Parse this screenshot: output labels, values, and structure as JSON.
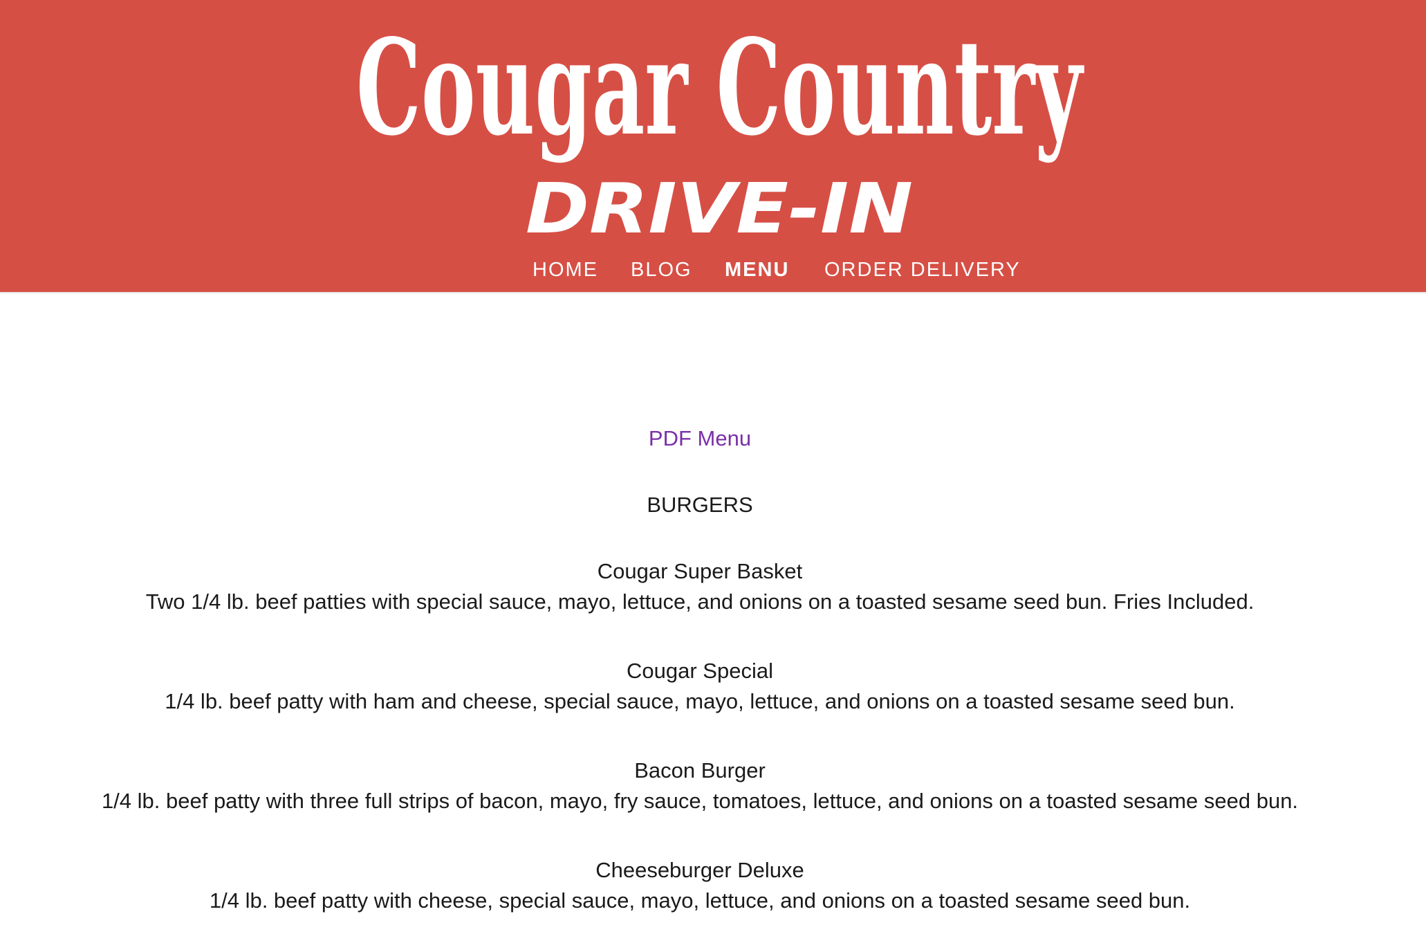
{
  "header": {
    "logo_line1": "Cougar Country",
    "logo_line2": "DRIVE-IN",
    "background_color": "#d64f45"
  },
  "nav": {
    "items": [
      {
        "label": "HOME",
        "active": false
      },
      {
        "label": "BLOG",
        "active": false
      },
      {
        "label": "MENU",
        "active": true
      },
      {
        "label": "ORDER DELIVERY",
        "active": false
      }
    ]
  },
  "main": {
    "pdf_link": "PDF Menu",
    "link_color": "#7a2fa8",
    "section_title": "BURGERS",
    "items": [
      {
        "name": "Cougar Super Basket",
        "description": "Two 1/4 lb. beef patties with special sauce, mayo, lettuce, and onions on a toasted sesame seed bun. Fries Included."
      },
      {
        "name": "Cougar Special",
        "description": "1/4 lb. beef patty with ham and cheese, special sauce, mayo, lettuce, and onions on a toasted sesame seed bun."
      },
      {
        "name": "Bacon Burger",
        "description": "1/4 lb. beef patty with three full strips of bacon, mayo, fry sauce, tomatoes, lettuce, and onions on a toasted sesame seed bun."
      },
      {
        "name": "Cheeseburger Deluxe",
        "description": "1/4 lb. beef patty with cheese, special sauce, mayo, lettuce, and onions on a toasted sesame seed bun."
      }
    ]
  }
}
